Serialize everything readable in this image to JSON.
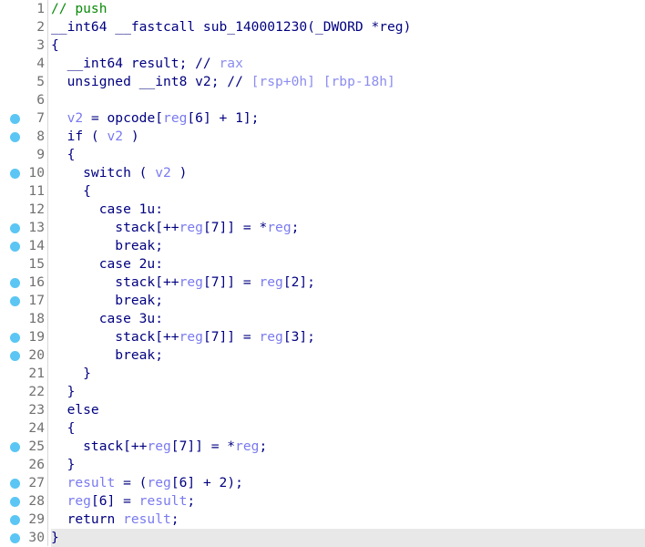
{
  "colors": {
    "keyword": "#000080",
    "variable": "#7a7af0",
    "comment": "#0a8a0a",
    "breakpoint": "#5bc6f4",
    "highlight": "#e8e8e8"
  },
  "highlighted_line": 30,
  "lines": [
    {
      "n": "1",
      "bp": false,
      "t": [
        [
          "// push",
          "c"
        ]
      ]
    },
    {
      "n": "2",
      "bp": false,
      "t": [
        [
          "__int64 __fastcall sub_140001230(_DWORD *reg)",
          "k"
        ]
      ]
    },
    {
      "n": "3",
      "bp": false,
      "t": [
        [
          "{",
          "k"
        ]
      ]
    },
    {
      "n": "4",
      "bp": false,
      "t": [
        [
          "  __int64 result; // ",
          "k"
        ],
        [
          "rax",
          "g"
        ]
      ]
    },
    {
      "n": "5",
      "bp": false,
      "t": [
        [
          "  unsigned __int8 v2; // ",
          "k"
        ],
        [
          "[rsp+0h] [rbp-18h]",
          "g"
        ]
      ]
    },
    {
      "n": "6",
      "bp": false,
      "t": []
    },
    {
      "n": "7",
      "bp": true,
      "t": [
        [
          "  ",
          "k"
        ],
        [
          "v2",
          "v"
        ],
        [
          " = opcode[",
          "k"
        ],
        [
          "reg",
          "v"
        ],
        [
          "[6] + 1];",
          "k"
        ]
      ]
    },
    {
      "n": "8",
      "bp": true,
      "t": [
        [
          "  if ( ",
          "k"
        ],
        [
          "v2",
          "v"
        ],
        [
          " )",
          "k"
        ]
      ]
    },
    {
      "n": "9",
      "bp": false,
      "t": [
        [
          "  {",
          "k"
        ]
      ]
    },
    {
      "n": "10",
      "bp": true,
      "t": [
        [
          "    switch ( ",
          "k"
        ],
        [
          "v2",
          "v"
        ],
        [
          " )",
          "k"
        ]
      ]
    },
    {
      "n": "11",
      "bp": false,
      "t": [
        [
          "    {",
          "k"
        ]
      ]
    },
    {
      "n": "12",
      "bp": false,
      "t": [
        [
          "      case 1u:",
          "k"
        ]
      ]
    },
    {
      "n": "13",
      "bp": true,
      "t": [
        [
          "        stack[++",
          "k"
        ],
        [
          "reg",
          "v"
        ],
        [
          "[7]] = *",
          "k"
        ],
        [
          "reg",
          "v"
        ],
        [
          ";",
          "k"
        ]
      ]
    },
    {
      "n": "14",
      "bp": true,
      "t": [
        [
          "        break;",
          "k"
        ]
      ]
    },
    {
      "n": "15",
      "bp": false,
      "t": [
        [
          "      case 2u:",
          "k"
        ]
      ]
    },
    {
      "n": "16",
      "bp": true,
      "t": [
        [
          "        stack[++",
          "k"
        ],
        [
          "reg",
          "v"
        ],
        [
          "[7]] = ",
          "k"
        ],
        [
          "reg",
          "v"
        ],
        [
          "[2];",
          "k"
        ]
      ]
    },
    {
      "n": "17",
      "bp": true,
      "t": [
        [
          "        break;",
          "k"
        ]
      ]
    },
    {
      "n": "18",
      "bp": false,
      "t": [
        [
          "      case 3u:",
          "k"
        ]
      ]
    },
    {
      "n": "19",
      "bp": true,
      "t": [
        [
          "        stack[++",
          "k"
        ],
        [
          "reg",
          "v"
        ],
        [
          "[7]] = ",
          "k"
        ],
        [
          "reg",
          "v"
        ],
        [
          "[3];",
          "k"
        ]
      ]
    },
    {
      "n": "20",
      "bp": true,
      "t": [
        [
          "        break;",
          "k"
        ]
      ]
    },
    {
      "n": "21",
      "bp": false,
      "t": [
        [
          "    }",
          "k"
        ]
      ]
    },
    {
      "n": "22",
      "bp": false,
      "t": [
        [
          "  }",
          "k"
        ]
      ]
    },
    {
      "n": "23",
      "bp": false,
      "t": [
        [
          "  else",
          "k"
        ]
      ]
    },
    {
      "n": "24",
      "bp": false,
      "t": [
        [
          "  {",
          "k"
        ]
      ]
    },
    {
      "n": "25",
      "bp": true,
      "t": [
        [
          "    stack[++",
          "k"
        ],
        [
          "reg",
          "v"
        ],
        [
          "[7]] = *",
          "k"
        ],
        [
          "reg",
          "v"
        ],
        [
          ";",
          "k"
        ]
      ]
    },
    {
      "n": "26",
      "bp": false,
      "t": [
        [
          "  }",
          "k"
        ]
      ]
    },
    {
      "n": "27",
      "bp": true,
      "t": [
        [
          "  ",
          "k"
        ],
        [
          "result",
          "v"
        ],
        [
          " = (",
          "k"
        ],
        [
          "reg",
          "v"
        ],
        [
          "[6] + 2);",
          "k"
        ]
      ]
    },
    {
      "n": "28",
      "bp": true,
      "t": [
        [
          "  ",
          "k"
        ],
        [
          "reg",
          "v"
        ],
        [
          "[6] = ",
          "k"
        ],
        [
          "result",
          "v"
        ],
        [
          ";",
          "k"
        ]
      ]
    },
    {
      "n": "29",
      "bp": true,
      "t": [
        [
          "  return ",
          "k"
        ],
        [
          "result",
          "v"
        ],
        [
          ";",
          "k"
        ]
      ]
    },
    {
      "n": "30",
      "bp": true,
      "t": [
        [
          "}",
          "k"
        ]
      ]
    }
  ]
}
